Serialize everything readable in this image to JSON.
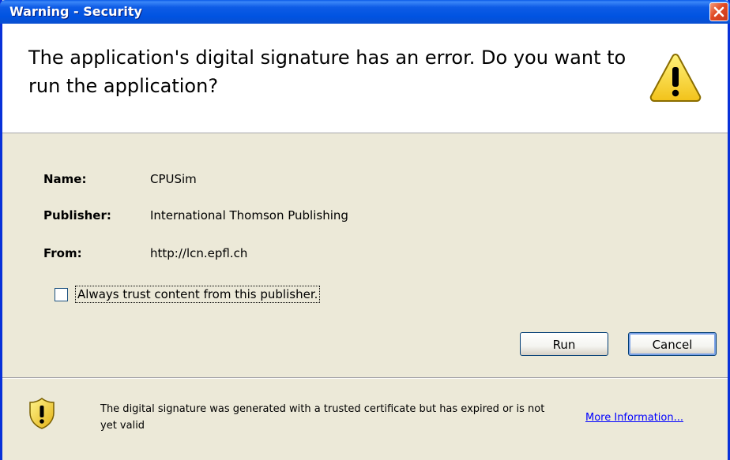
{
  "window": {
    "title": "Warning - Security"
  },
  "header": {
    "message": "The application's digital signature has an error.  Do you want to run the application?",
    "icon": "warning-icon"
  },
  "details": {
    "name_label": "Name:",
    "name_value": "CPUSim",
    "publisher_label": "Publisher:",
    "publisher_value": "International Thomson Publishing",
    "from_label": "From:",
    "from_value": "http://lcn.epfl.ch"
  },
  "trust_checkbox": {
    "label": "Always trust content from this publisher.",
    "checked": false
  },
  "buttons": {
    "run": "Run",
    "cancel": "Cancel"
  },
  "footer": {
    "message": "The digital signature was generated with a trusted certificate but has expired or is not yet valid",
    "link": "More Information...",
    "icon": "shield-warning-icon"
  },
  "colors": {
    "titlebar": "#0053E1",
    "dialog_bg": "#ECE9D8",
    "link": "#0000FF",
    "warning": "#F7D32A"
  }
}
